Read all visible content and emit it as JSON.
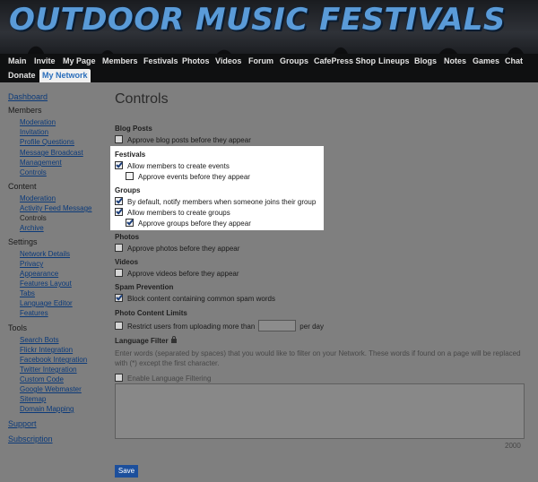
{
  "header": {
    "site_title": "OUTDOOR MUSIC FESTIVALS"
  },
  "nav": {
    "row1": [
      "Main",
      "Invite",
      "My Page",
      "Members",
      "Festivals",
      "Photos",
      "Videos",
      "Forum",
      "Groups",
      "CafePress Shop",
      "Lineups",
      "Blogs",
      "Notes",
      "Games",
      "Chat"
    ],
    "row2": [
      "Donate",
      "My Network"
    ],
    "active": "My Network"
  },
  "sidebar": {
    "dashboard": "Dashboard",
    "members_heading": "Members",
    "members_items": [
      "Moderation",
      "Invitation",
      "Profile Questions",
      "Message Broadcast",
      "Management",
      "Controls"
    ],
    "content_heading": "Content",
    "content_items": [
      "Moderation",
      "Activity Feed Message",
      "Controls",
      "Archive"
    ],
    "settings_heading": "Settings",
    "settings_items": [
      "Network Details",
      "Privacy",
      "Appearance",
      "Features Layout",
      "Tabs",
      "Language Editor",
      "Features"
    ],
    "tools_heading": "Tools",
    "tools_items": [
      "Search Bots",
      "Flickr Integration",
      "Facebook Integration",
      "Twitter Integration",
      "Custom Code",
      "Google Webmaster",
      "Sitemap",
      "Domain Mapping"
    ],
    "support": "Support",
    "subscription": "Subscription"
  },
  "main": {
    "title": "Controls",
    "blog_posts": {
      "title": "Blog Posts",
      "approve": "Approve blog posts before they appear",
      "approve_checked": false
    },
    "festivals": {
      "title": "Festivals",
      "allow": "Allow members to create events",
      "allow_checked": true,
      "approve": "Approve events before they appear",
      "approve_checked": false
    },
    "groups": {
      "title": "Groups",
      "notify": "By default, notify members when someone joins their group",
      "notify_checked": true,
      "allow": "Allow members to create groups",
      "allow_checked": true,
      "approve": "Approve groups before they appear",
      "approve_checked": true
    },
    "photos": {
      "title": "Photos",
      "approve": "Approve photos before they appear",
      "approve_checked": false
    },
    "videos": {
      "title": "Videos",
      "approve": "Approve videos before they appear",
      "approve_checked": false
    },
    "spam": {
      "title": "Spam Prevention",
      "block": "Block content containing common spam words",
      "block_checked": true
    },
    "photo_limits": {
      "title": "Photo Content Limits",
      "restrict_prefix": "Restrict users from uploading more than",
      "restrict_suffix": "per day",
      "restrict_checked": false,
      "value": ""
    },
    "language_filter": {
      "title": "Language Filter",
      "description": "Enter words (separated by spaces) that you would like to filter on your Network. These words if found on a page will be replaced with (*) except the first character.",
      "enable": "Enable Language Filtering",
      "enable_checked": false,
      "char_count": "2000"
    },
    "save_label": "Save"
  }
}
